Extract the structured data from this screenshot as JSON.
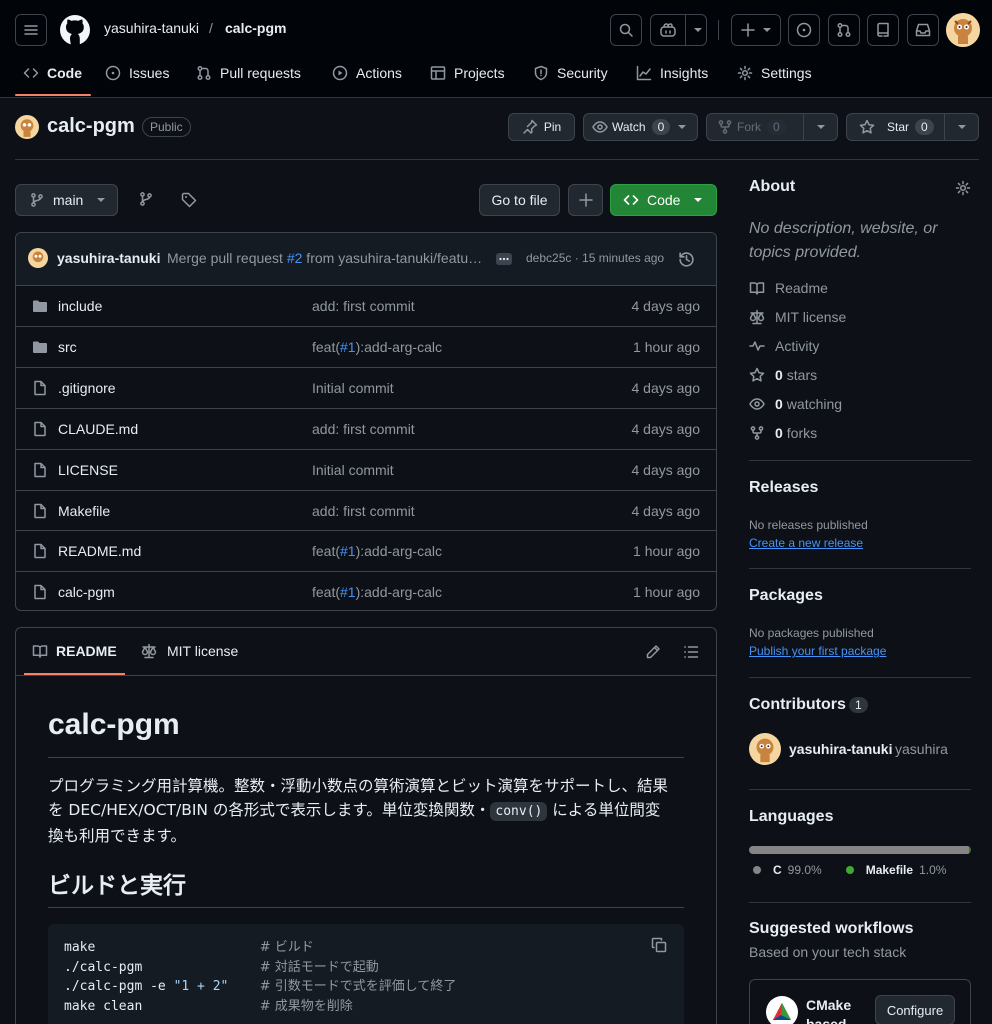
{
  "header": {
    "owner": "yasuhira-tanuki",
    "separator": "/",
    "repo": "calc-pgm"
  },
  "nav": {
    "code": "Code",
    "issues": "Issues",
    "pulls": "Pull requests",
    "actions": "Actions",
    "projects": "Projects",
    "security": "Security",
    "insights": "Insights",
    "settings": "Settings"
  },
  "repo": {
    "name": "calc-pgm",
    "visibility": "Public",
    "pin": "Pin",
    "watch": "Watch",
    "watch_count": "0",
    "fork": "Fork",
    "fork_count": "0",
    "star": "Star",
    "star_count": "0"
  },
  "toolbar": {
    "branch": "main",
    "go_to_file": "Go to file",
    "code": "Code"
  },
  "commit": {
    "author": "yasuhira-tanuki",
    "message_prefix": "Merge pull request ",
    "pr_ref": "#2",
    "message_suffix": " from yasuhira-tanuki/featu…",
    "meta": "debc25c · 15 minutes ago"
  },
  "files": [
    {
      "type": "dir",
      "name": "include",
      "pre": "add: first commit",
      "ref": "",
      "post": "",
      "date": "4 days ago"
    },
    {
      "type": "dir",
      "name": "src",
      "pre": "feat(",
      "ref": "#1",
      "post": "):add-arg-calc",
      "date": "1 hour ago"
    },
    {
      "type": "file",
      "name": ".gitignore",
      "pre": "Initial commit",
      "ref": "",
      "post": "",
      "date": "4 days ago"
    },
    {
      "type": "file",
      "name": "CLAUDE.md",
      "pre": "add: first commit",
      "ref": "",
      "post": "",
      "date": "4 days ago"
    },
    {
      "type": "file",
      "name": "LICENSE",
      "pre": "Initial commit",
      "ref": "",
      "post": "",
      "date": "4 days ago"
    },
    {
      "type": "file",
      "name": "Makefile",
      "pre": "add: first commit",
      "ref": "",
      "post": "",
      "date": "4 days ago"
    },
    {
      "type": "file",
      "name": "README.md",
      "pre": "feat(",
      "ref": "#1",
      "post": "):add-arg-calc",
      "date": "1 hour ago"
    },
    {
      "type": "file",
      "name": "calc-pgm",
      "pre": "feat(",
      "ref": "#1",
      "post": "):add-arg-calc",
      "date": "1 hour ago"
    }
  ],
  "readme": {
    "tab_readme": "README",
    "tab_license": "MIT license",
    "h1": "calc-pgm",
    "p1_line1": "プログラミング用計算機。整数・浮動小数点の算術演算とビット演算をサポートし、結果",
    "p1_line2a": "を DEC/HEX/OCT/BIN の各形式で表示します。単位変換関数・",
    "p1_code": "conv()",
    "p1_line2b": " による単位間変",
    "p1_line3": "換も利用できます。",
    "h2": "ビルドと実行",
    "code_lines": [
      {
        "cmd": "make",
        "str": "",
        "comment": "# ビルド"
      },
      {
        "cmd": "./calc-pgm",
        "str": "",
        "comment": "# 対話モードで起動"
      },
      {
        "cmd": "./calc-pgm -e ",
        "str": "\"1 + 2\"",
        "comment": "# 引数モードで式を評価して終了"
      },
      {
        "cmd": "make clean",
        "str": "",
        "comment": "# 成果物を削除"
      }
    ]
  },
  "about": {
    "title": "About",
    "description_line1": "No description, website, or",
    "description_line2": "topics provided.",
    "readme": "Readme",
    "license": "MIT license",
    "activity": "Activity",
    "stars_n": "0",
    "stars": "stars",
    "watching_n": "0",
    "watching": "watching",
    "forks_n": "0",
    "forks": "forks"
  },
  "releases": {
    "title": "Releases",
    "none": "No releases published",
    "create": "Create a new release"
  },
  "packages": {
    "title": "Packages",
    "none": "No packages published",
    "publish": "Publish your first package"
  },
  "contributors": {
    "title": "Contributors",
    "count": "1",
    "user": "yasuhira-tanuki",
    "user_short": "yasuhira"
  },
  "languages": {
    "title": "Languages",
    "items": [
      {
        "name": "C",
        "percent": "99.0%",
        "share": 99.0,
        "color": "#555555"
      },
      {
        "name": "Makefile",
        "percent": "1.0%",
        "share": 1.0,
        "color": "#427819"
      }
    ]
  },
  "workflows": {
    "title": "Suggested workflows",
    "subtitle": "Based on your tech stack",
    "item_name_line1": "CMake",
    "item_name_line2": "based",
    "configure": "Configure"
  },
  "colors": {
    "accent": "#4493f8",
    "code_button": "#238636",
    "underline": "#f78166"
  }
}
